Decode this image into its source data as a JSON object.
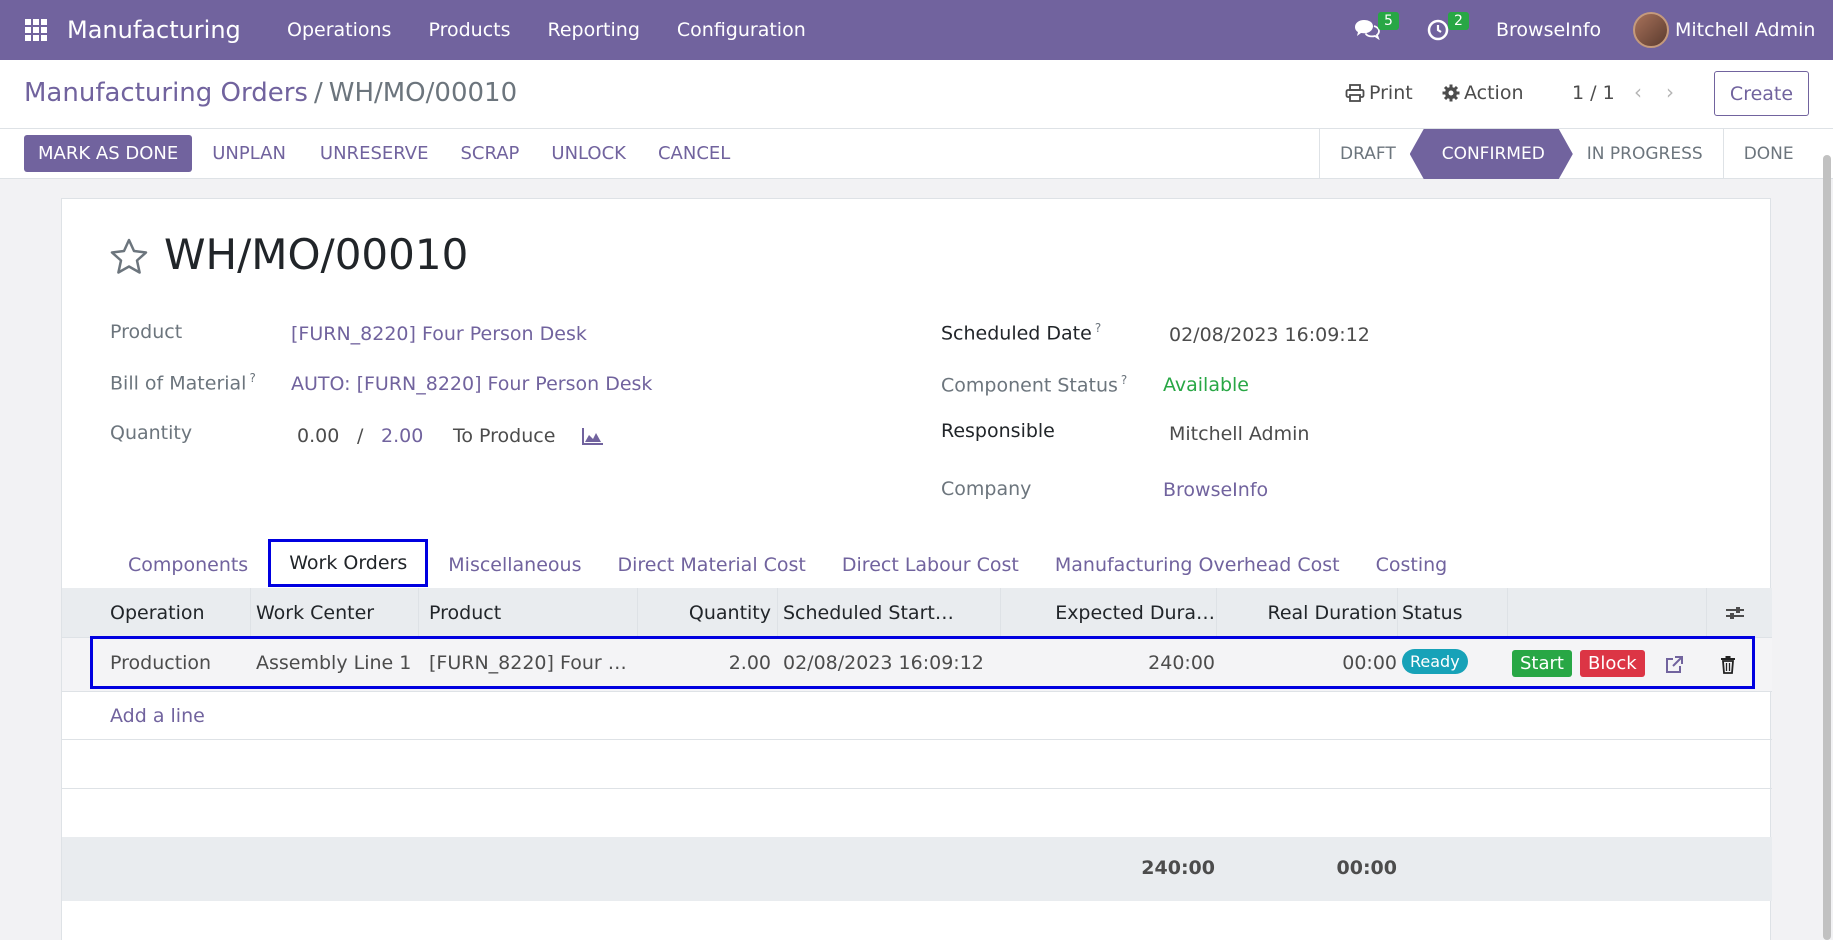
{
  "navbar": {
    "app_name": "Manufacturing",
    "menu": [
      "Operations",
      "Products",
      "Reporting",
      "Configuration"
    ],
    "messages_count": "5",
    "activities_count": "2",
    "company": "BrowseInfo",
    "user": "Mitchell Admin"
  },
  "control": {
    "breadcrumb_parent": "Manufacturing Orders",
    "breadcrumb_sep": "/",
    "breadcrumb_current": "WH/MO/00010",
    "print_label": "Print",
    "action_label": "Action",
    "pager": "1 / 1",
    "create_label": "Create",
    "buttons": {
      "mark_done": "MARK AS DONE",
      "unplan": "UNPLAN",
      "unreserve": "UNRESERVE",
      "scrap": "SCRAP",
      "unlock": "UNLOCK",
      "cancel": "CANCEL"
    },
    "stages": [
      "DRAFT",
      "CONFIRMED",
      "IN PROGRESS",
      "DONE"
    ],
    "active_stage": "CONFIRMED"
  },
  "form": {
    "title": "WH/MO/00010",
    "product_label": "Product",
    "product_value": "[FURN_8220] Four Person Desk",
    "bom_label": "Bill of Material",
    "bom_value": "AUTO: [FURN_8220] Four Person Desk",
    "quantity_label": "Quantity",
    "quantity_produced": "0.00",
    "quantity_sep": "/",
    "quantity_total": "2.00",
    "quantity_unit": "To Produce",
    "scheduled_label": "Scheduled Date",
    "scheduled_value": "02/08/2023 16:09:12",
    "component_status_label": "Component Status",
    "component_status_value": "Available",
    "responsible_label": "Responsible",
    "responsible_value": "Mitchell Admin",
    "company_label": "Company",
    "company_value": "BrowseInfo",
    "help_mark": "?"
  },
  "tabs": [
    "Components",
    "Work Orders",
    "Miscellaneous",
    "Direct Material Cost",
    "Direct Labour Cost",
    "Manufacturing Overhead Cost",
    "Costing"
  ],
  "active_tab": "Work Orders",
  "work_orders": {
    "columns": [
      "Operation",
      "Work Center",
      "Product",
      "Quantity",
      "Scheduled Start…",
      "Expected Dura…",
      "Real Duration",
      "Status"
    ],
    "rows": [
      {
        "operation": "Production",
        "work_center": "Assembly Line 1",
        "product": "[FURN_8220] Four …",
        "quantity": "2.00",
        "scheduled_start": "02/08/2023 16:09:12",
        "expected_duration": "240:00",
        "real_duration": "00:00",
        "status": "Ready",
        "start_label": "Start",
        "block_label": "Block"
      }
    ],
    "add_line": "Add a line",
    "total_expected": "240:00",
    "total_real": "00:00"
  }
}
